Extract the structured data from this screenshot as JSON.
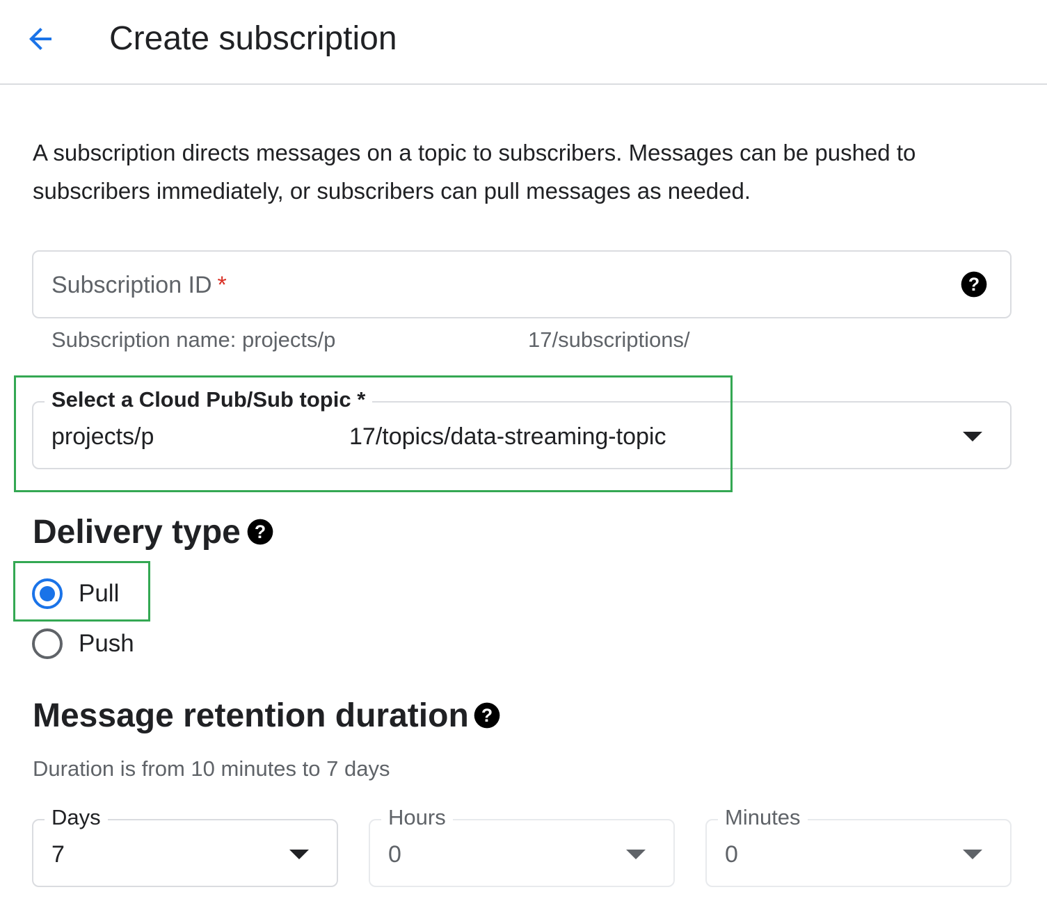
{
  "header": {
    "title": "Create subscription",
    "back_icon": "arrow-back-icon",
    "accent_color": "#1a73e8"
  },
  "intro_text": "A subscription directs messages on a topic to subscribers. Messages can be pushed to subscribers immediately, or subscribers can pull messages as needed.",
  "subscription_id": {
    "placeholder": "Subscription ID",
    "required_mark": "*",
    "value": "",
    "help_icon": "help-icon",
    "helper_prefix": "Subscription name: projects/p",
    "helper_suffix": "17/subscriptions/"
  },
  "topic": {
    "label": "Select a Cloud Pub/Sub topic *",
    "value_prefix": "projects/p",
    "value_suffix": "17/topics/data-streaming-topic",
    "dropdown_icon": "arrow-drop-down-icon"
  },
  "delivery_type": {
    "title": "Delivery type",
    "help_icon": "help-icon",
    "options": [
      {
        "label": "Pull",
        "selected": true
      },
      {
        "label": "Push",
        "selected": false
      }
    ]
  },
  "retention": {
    "title": "Message retention duration",
    "help_icon": "help-icon",
    "hint": "Duration is from 10 minutes to 7 days",
    "days": {
      "label": "Days",
      "value": "7"
    },
    "hours": {
      "label": "Hours",
      "value": "0"
    },
    "minutes": {
      "label": "Minutes",
      "value": "0"
    }
  },
  "colors": {
    "highlight": "#34a853",
    "required": "#d93025",
    "radio_selected": "#1a73e8"
  }
}
